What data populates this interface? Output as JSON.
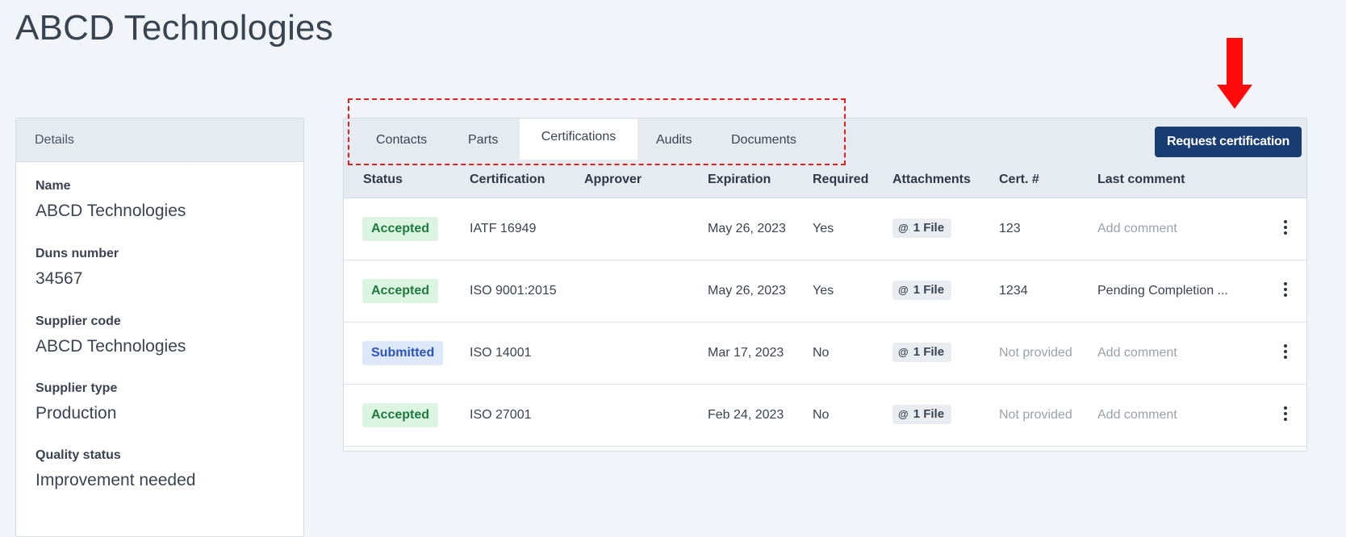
{
  "page": {
    "title": "ABCD Technologies"
  },
  "details": {
    "header": "Details",
    "fields": [
      {
        "label": "Name",
        "value": "ABCD Technologies"
      },
      {
        "label": "Duns number",
        "value": "34567"
      },
      {
        "label": "Supplier code",
        "value": "ABCD Technologies"
      },
      {
        "label": "Supplier type",
        "value": "Production"
      },
      {
        "label": "Quality status",
        "value": "Improvement needed"
      }
    ]
  },
  "tabs": [
    {
      "label": "Contacts",
      "active": false
    },
    {
      "label": "Parts",
      "active": false
    },
    {
      "label": "Certifications",
      "active": true
    },
    {
      "label": "Audits",
      "active": false
    },
    {
      "label": "Documents",
      "active": false
    }
  ],
  "toolbar": {
    "request_label": "Request certification"
  },
  "table": {
    "columns": [
      "Status",
      "Certification",
      "Approver",
      "Expiration",
      "Required",
      "Attachments",
      "Cert. #",
      "Last comment"
    ],
    "rows": [
      {
        "status": "Accepted",
        "certification": "IATF 16949",
        "approver": "",
        "expiration": "May 26, 2023",
        "required": "Yes",
        "attachments": "1 File",
        "cert": "123",
        "comment": "Add comment"
      },
      {
        "status": "Accepted",
        "certification": "ISO 9001:2015",
        "approver": "",
        "expiration": "May 26, 2023",
        "required": "Yes",
        "attachments": "1 File",
        "cert": "1234",
        "comment": "Pending Completion ..."
      },
      {
        "status": "Submitted",
        "certification": "ISO 14001",
        "approver": "",
        "expiration": "Mar 17, 2023",
        "required": "No",
        "attachments": "1 File",
        "cert": "Not provided",
        "comment": "Add comment"
      },
      {
        "status": "Accepted",
        "certification": "ISO 27001",
        "approver": "",
        "expiration": "Feb 24, 2023",
        "required": "No",
        "attachments": "1 File",
        "cert": "Not provided",
        "comment": "Add comment"
      }
    ]
  },
  "icons": {
    "attachment": "paperclip-icon",
    "row_menu": "kebab-menu-icon",
    "annotation": "red-down-arrow"
  },
  "colors": {
    "accent": "#183d73",
    "accepted_bg": "#dcf5e3",
    "accepted_text": "#1f7a3d",
    "submitted_bg": "#dde8fb",
    "submitted_text": "#2c54b8",
    "annotation": "#e02020"
  }
}
